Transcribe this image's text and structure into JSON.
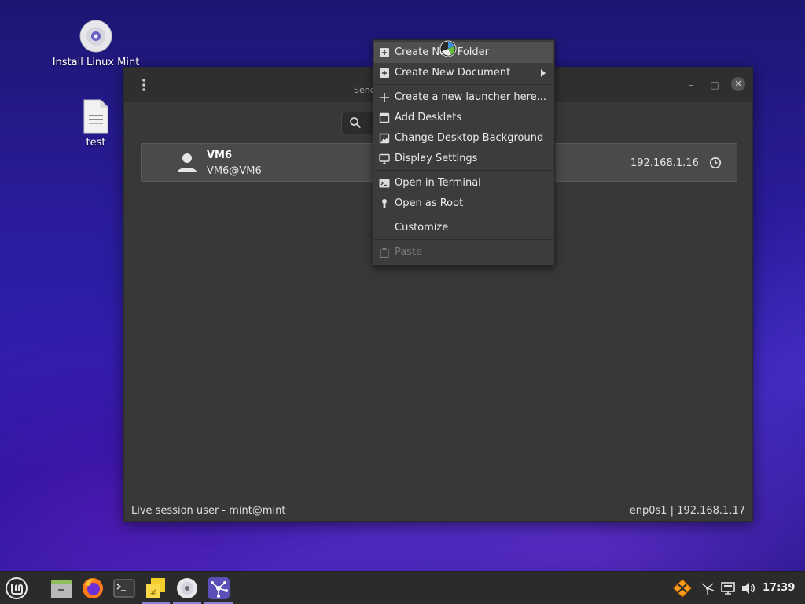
{
  "desktop": {
    "icons": [
      {
        "label": "Install Linux Mint",
        "icon": "disc-icon"
      },
      {
        "label": "test",
        "icon": "text-file-icon"
      }
    ]
  },
  "window": {
    "title": "Send",
    "search": {
      "placeholder": ""
    },
    "peer": {
      "name": "VM6",
      "host": "VM6@VM6",
      "ip": "192.168.1.16",
      "status_icon": "clock-icon"
    },
    "status_left": "Live session user - mint@mint",
    "status_right": "enp0s1  |  192.168.1.17"
  },
  "context_menu": {
    "items": [
      {
        "label": "Create New Folder",
        "icon": "new-folder-icon"
      },
      {
        "label": "Create New Document",
        "icon": "new-document-icon",
        "submenu": true
      },
      {
        "label": "Create a new launcher here...",
        "icon": "plus-icon"
      },
      {
        "label": "Add Desklets",
        "icon": "desklet-icon"
      },
      {
        "label": "Change Desktop Background",
        "icon": "image-icon"
      },
      {
        "label": "Display Settings",
        "icon": "monitor-icon"
      },
      {
        "label": "Open in Terminal",
        "icon": "terminal-icon"
      },
      {
        "label": "Open as Root",
        "icon": "root-icon"
      },
      {
        "label": "Customize",
        "icon": ""
      },
      {
        "label": "Paste",
        "icon": "clipboard-icon",
        "disabled": true
      }
    ]
  },
  "taskbar": {
    "clock": "17:39",
    "apps": [
      "mint-menu-icon",
      "file-manager-icon",
      "firefox-icon",
      "terminal-icon",
      "notes-icon",
      "disc-icon",
      "warpinator-icon"
    ],
    "tray": [
      "update-icon",
      "network-share-icon",
      "network-icon",
      "volume-icon"
    ]
  },
  "colors": {
    "accent": "#8d7fd6",
    "menu_bg": "#3c3c3c",
    "window_bg": "#383838"
  }
}
